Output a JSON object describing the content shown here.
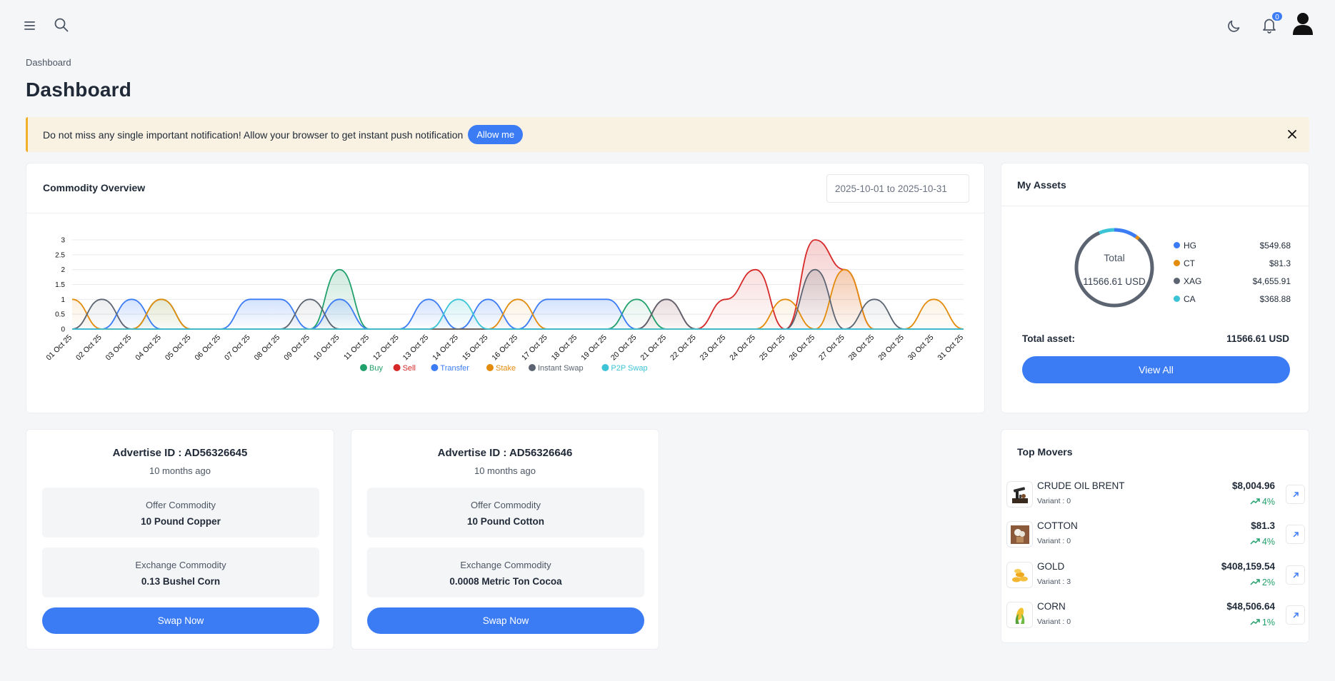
{
  "topbar": {
    "notification_count": "0",
    "icons": [
      "hamburger-menu-icon",
      "search-icon",
      "moon-icon",
      "bell-icon",
      "user-avatar-icon"
    ]
  },
  "breadcrumb": "Dashboard",
  "page_title": "Dashboard",
  "alert": {
    "text": "Do not miss any single important notification! Allow your browser to get instant push notification",
    "button_label": "Allow me"
  },
  "commodity_overview": {
    "title": "Commodity Overview",
    "date_range": "2025-10-01 to 2025-10-31"
  },
  "my_assets": {
    "title": "My Assets",
    "total_label": "Total",
    "total_value": "11566.61 USD",
    "items": [
      {
        "name": "HG",
        "value": "$549.68",
        "amount": 549.68,
        "color": "#3b7cf5"
      },
      {
        "name": "CT",
        "value": "$81.3",
        "amount": 81.3,
        "color": "#e38b0a"
      },
      {
        "name": "XAG",
        "value": "$4,655.91",
        "amount": 4655.91,
        "color": "#5b6470"
      },
      {
        "name": "CA",
        "value": "$368.88",
        "amount": 368.88,
        "color": "#3cc4d6"
      }
    ],
    "total_asset_label": "Total asset:",
    "total_asset_value": "11566.61 USD",
    "view_all_label": "View All"
  },
  "advertisements": [
    {
      "title": "Advertise ID : AD56326645",
      "time": "10 months ago",
      "offer_label": "Offer Commodity",
      "offer_value": "10 Pound Copper",
      "exchange_label": "Exchange Commodity",
      "exchange_value": "0.13 Bushel Corn",
      "button_label": "Swap Now"
    },
    {
      "title": "Advertise ID : AD56326646",
      "time": "10 months ago",
      "offer_label": "Offer Commodity",
      "offer_value": "10 Pound Cotton",
      "exchange_label": "Exchange Commodity",
      "exchange_value": "0.0008 Metric Ton Cocoa",
      "button_label": "Swap Now"
    }
  ],
  "top_movers": {
    "title": "Top Movers",
    "items": [
      {
        "name": "CRUDE OIL BRENT",
        "variant": "Variant : 0",
        "price": "$8,004.96",
        "change": "4%",
        "icon": "oil-pump-icon"
      },
      {
        "name": "COTTON",
        "variant": "Variant : 0",
        "price": "$81.3",
        "change": "4%",
        "icon": "cotton-icon"
      },
      {
        "name": "GOLD",
        "variant": "Variant : 3",
        "price": "$408,159.54",
        "change": "2%",
        "icon": "gold-coins-icon"
      },
      {
        "name": "CORN",
        "variant": "Variant : 0",
        "price": "$48,506.64",
        "change": "1%",
        "icon": "corn-icon"
      }
    ]
  },
  "chart_data": {
    "type": "area",
    "categories": [
      "01 Oct 25",
      "02 Oct 25",
      "03 Oct 25",
      "04 Oct 25",
      "05 Oct 25",
      "06 Oct 25",
      "07 Oct 25",
      "08 Oct 25",
      "09 Oct 25",
      "10 Oct 25",
      "11 Oct 25",
      "12 Oct 25",
      "13 Oct 25",
      "14 Oct 25",
      "15 Oct 25",
      "16 Oct 25",
      "17 Oct 25",
      "18 Oct 25",
      "19 Oct 25",
      "20 Oct 25",
      "21 Oct 25",
      "22 Oct 25",
      "23 Oct 25",
      "24 Oct 25",
      "25 Oct 25",
      "26 Oct 25",
      "27 Oct 25",
      "28 Oct 25",
      "29 Oct 25",
      "30 Oct 25",
      "31 Oct 25"
    ],
    "y_ticks": [
      0,
      0.5,
      1,
      1.5,
      2,
      2.5,
      3
    ],
    "ylim": [
      0,
      3
    ],
    "grid": true,
    "legend_position": "bottom",
    "series": [
      {
        "name": "Buy",
        "color": "#22a06b",
        "values": [
          0,
          0,
          0,
          1,
          0,
          0,
          0,
          0,
          0,
          2,
          0,
          0,
          0,
          0,
          0,
          0,
          0,
          0,
          0,
          1,
          0,
          0,
          0,
          0,
          0,
          0,
          0,
          0,
          0,
          0,
          0
        ]
      },
      {
        "name": "Sell",
        "color": "#d62828",
        "values": [
          0,
          0,
          0,
          0,
          0,
          0,
          0,
          0,
          0,
          0,
          0,
          0,
          0,
          0,
          0,
          0,
          0,
          0,
          0,
          0,
          1,
          0,
          1,
          2,
          0,
          3,
          2,
          0,
          0,
          0,
          0
        ]
      },
      {
        "name": "Transfer",
        "color": "#3b7cf5",
        "values": [
          0,
          0,
          1,
          0,
          0,
          0,
          1,
          1,
          0,
          1,
          0,
          0,
          1,
          0,
          1,
          0,
          1,
          1,
          1,
          0,
          0,
          0,
          0,
          0,
          0,
          0,
          0,
          0,
          0,
          0,
          0
        ]
      },
      {
        "name": "Stake",
        "color": "#e38b0a",
        "values": [
          1,
          0,
          0,
          1,
          0,
          0,
          0,
          0,
          0,
          0,
          0,
          0,
          0,
          0,
          0,
          1,
          0,
          0,
          0,
          0,
          0,
          0,
          0,
          0,
          1,
          0,
          2,
          0,
          0,
          1,
          0
        ]
      },
      {
        "name": "Instant Swap",
        "color": "#5b6470",
        "values": [
          0,
          1,
          0,
          0,
          0,
          0,
          0,
          0,
          1,
          0,
          0,
          0,
          0,
          0,
          0,
          0,
          0,
          0,
          0,
          0,
          1,
          0,
          0,
          0,
          0,
          2,
          0,
          1,
          0,
          0,
          0
        ]
      },
      {
        "name": "P2P Swap",
        "color": "#3cc4d6",
        "values": [
          0,
          0,
          0,
          0,
          0,
          0,
          0,
          0,
          0,
          0,
          0,
          0,
          0,
          1,
          0,
          0,
          0,
          0,
          0,
          0,
          0,
          0,
          0,
          0,
          0,
          0,
          0,
          0,
          0,
          0,
          0
        ]
      }
    ]
  }
}
